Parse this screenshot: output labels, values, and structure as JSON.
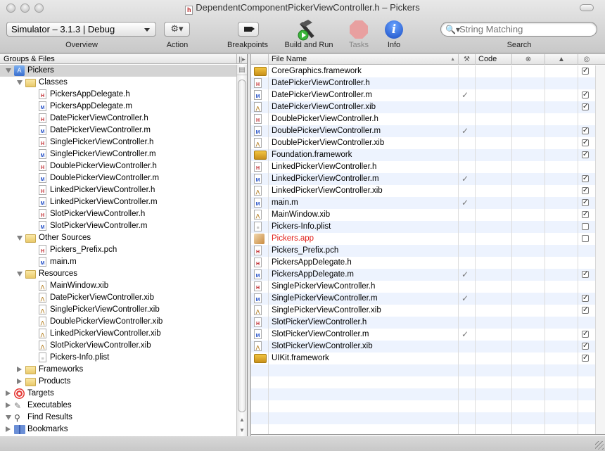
{
  "window": {
    "title": "DependentComponentPickerViewController.h – Pickers",
    "title_icon": "h"
  },
  "toolbar": {
    "overview_popup": "Simulator – 3.1.3 | Debug",
    "overview_label": "Overview",
    "action_glyph": "⚙▾",
    "action_label": "Action",
    "breakpoints_label": "Breakpoints",
    "build_run_label": "Build and Run",
    "tasks_label": "Tasks",
    "info_glyph": "i",
    "info_label": "Info",
    "search_placeholder": "String Matching",
    "search_value": "",
    "search_label": "Search",
    "search_icon": "🔍▾"
  },
  "groups": {
    "header": "Groups & Files",
    "header_button": "||▸",
    "tree": [
      {
        "label": "Pickers",
        "level": 0,
        "kind": "project",
        "disclosure": "open",
        "selected": true
      },
      {
        "label": "Classes",
        "level": 1,
        "kind": "folder",
        "disclosure": "open"
      },
      {
        "label": "PickersAppDelegate.h",
        "level": 2,
        "kind": "h"
      },
      {
        "label": "PickersAppDelegate.m",
        "level": 2,
        "kind": "m"
      },
      {
        "label": "DatePickerViewController.h",
        "level": 2,
        "kind": "h"
      },
      {
        "label": "DatePickerViewController.m",
        "level": 2,
        "kind": "m"
      },
      {
        "label": "SinglePickerViewController.h",
        "level": 2,
        "kind": "h"
      },
      {
        "label": "SinglePickerViewController.m",
        "level": 2,
        "kind": "m"
      },
      {
        "label": "DoublePickerViewController.h",
        "level": 2,
        "kind": "h"
      },
      {
        "label": "DoublePickerViewController.m",
        "level": 2,
        "kind": "m"
      },
      {
        "label": "LinkedPickerViewController.h",
        "level": 2,
        "kind": "h"
      },
      {
        "label": "LinkedPickerViewController.m",
        "level": 2,
        "kind": "m"
      },
      {
        "label": "SlotPickerViewController.h",
        "level": 2,
        "kind": "h"
      },
      {
        "label": "SlotPickerViewController.m",
        "level": 2,
        "kind": "m"
      },
      {
        "label": "Other Sources",
        "level": 1,
        "kind": "folder",
        "disclosure": "open"
      },
      {
        "label": "Pickers_Prefix.pch",
        "level": 2,
        "kind": "h"
      },
      {
        "label": "main.m",
        "level": 2,
        "kind": "m"
      },
      {
        "label": "Resources",
        "level": 1,
        "kind": "folder",
        "disclosure": "open"
      },
      {
        "label": "MainWindow.xib",
        "level": 2,
        "kind": "xib"
      },
      {
        "label": "DatePickerViewController.xib",
        "level": 2,
        "kind": "xib"
      },
      {
        "label": "SinglePickerViewController.xib",
        "level": 2,
        "kind": "xib"
      },
      {
        "label": "DoublePickerViewController.xib",
        "level": 2,
        "kind": "xib"
      },
      {
        "label": "LinkedPickerViewController.xib",
        "level": 2,
        "kind": "xib"
      },
      {
        "label": "SlotPickerViewController.xib",
        "level": 2,
        "kind": "xib"
      },
      {
        "label": "Pickers-Info.plist",
        "level": 2,
        "kind": "plist"
      },
      {
        "label": "Frameworks",
        "level": 1,
        "kind": "folder",
        "disclosure": "closed"
      },
      {
        "label": "Products",
        "level": 1,
        "kind": "folder",
        "disclosure": "closed"
      },
      {
        "label": "Targets",
        "level": 0,
        "kind": "targets",
        "disclosure": "closed"
      },
      {
        "label": "Executables",
        "level": 0,
        "kind": "executables",
        "disclosure": "closed"
      },
      {
        "label": "Find Results",
        "level": 0,
        "kind": "find",
        "disclosure": "open"
      },
      {
        "label": "Bookmarks",
        "level": 0,
        "kind": "bookmarks",
        "disclosure": "closed"
      }
    ]
  },
  "files": {
    "columns": {
      "file_name": "File Name",
      "sort_indicator": "▲",
      "build": "⚒",
      "code": "Code",
      "errors": "⊗",
      "warnings": "▲",
      "target": "◎"
    },
    "rows": [
      {
        "name": "CoreGraphics.framework",
        "kind": "framework",
        "built": false,
        "target": true
      },
      {
        "name": "DatePickerViewController.h",
        "kind": "h",
        "built": false,
        "target": null
      },
      {
        "name": "DatePickerViewController.m",
        "kind": "m",
        "built": true,
        "target": true
      },
      {
        "name": "DatePickerViewController.xib",
        "kind": "xib",
        "built": false,
        "target": true
      },
      {
        "name": "DoublePickerViewController.h",
        "kind": "h",
        "built": false,
        "target": null
      },
      {
        "name": "DoublePickerViewController.m",
        "kind": "m",
        "built": true,
        "target": true
      },
      {
        "name": "DoublePickerViewController.xib",
        "kind": "xib",
        "built": false,
        "target": true
      },
      {
        "name": "Foundation.framework",
        "kind": "framework",
        "built": false,
        "target": true
      },
      {
        "name": "LinkedPickerViewController.h",
        "kind": "h",
        "built": false,
        "target": null
      },
      {
        "name": "LinkedPickerViewController.m",
        "kind": "m",
        "built": true,
        "target": true
      },
      {
        "name": "LinkedPickerViewController.xib",
        "kind": "xib",
        "built": false,
        "target": true
      },
      {
        "name": "main.m",
        "kind": "m",
        "built": true,
        "target": true
      },
      {
        "name": "MainWindow.xib",
        "kind": "xib",
        "built": false,
        "target": true
      },
      {
        "name": "Pickers-Info.plist",
        "kind": "plist",
        "built": false,
        "target": false
      },
      {
        "name": "Pickers.app",
        "kind": "app",
        "built": false,
        "target": false,
        "missing": true
      },
      {
        "name": "Pickers_Prefix.pch",
        "kind": "h",
        "built": false,
        "target": null
      },
      {
        "name": "PickersAppDelegate.h",
        "kind": "h",
        "built": false,
        "target": null
      },
      {
        "name": "PickersAppDelegate.m",
        "kind": "m",
        "built": true,
        "target": true
      },
      {
        "name": "SinglePickerViewController.h",
        "kind": "h",
        "built": false,
        "target": null
      },
      {
        "name": "SinglePickerViewController.m",
        "kind": "m",
        "built": true,
        "target": true
      },
      {
        "name": "SinglePickerViewController.xib",
        "kind": "xib",
        "built": false,
        "target": true
      },
      {
        "name": "SlotPickerViewController.h",
        "kind": "h",
        "built": false,
        "target": null
      },
      {
        "name": "SlotPickerViewController.m",
        "kind": "m",
        "built": true,
        "target": true
      },
      {
        "name": "SlotPickerViewController.xib",
        "kind": "xib",
        "built": false,
        "target": true
      },
      {
        "name": "UIKit.framework",
        "kind": "framework",
        "built": false,
        "target": true
      }
    ],
    "missing_color": "#e0201b",
    "stripe_color": "#edf3fe"
  }
}
